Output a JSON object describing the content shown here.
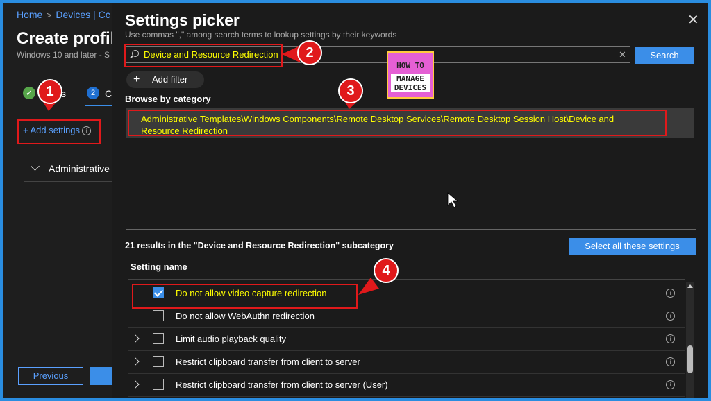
{
  "breadcrumb": {
    "home": "Home",
    "devices": "Devices | Cc"
  },
  "profile": {
    "title": "Create profil",
    "subtitle": "Windows 10 and later - S",
    "step1_label": "s",
    "step2_number": "2",
    "step2_label": "C",
    "add_settings": "+ Add settings",
    "admin_row": "Administrative",
    "previous": "Previous"
  },
  "picker": {
    "title": "Settings picker",
    "hint": "Use commas \",\" among search terms to lookup settings by their keywords",
    "search_value": "Device and Resource Redirection",
    "search_button": "Search",
    "add_filter": "Add filter",
    "browse_label": "Browse by category",
    "category_path": "Administrative Templates\\Windows Components\\Remote Desktop Services\\Remote Desktop Session Host\\Device and Resource Redirection",
    "results_text": "21 results in the \"Device and Resource Redirection\" subcategory",
    "select_all": "Select all these settings",
    "column_header": "Setting name",
    "rows": [
      {
        "name": "Do not allow video capture redirection",
        "checked": true,
        "expandable": false
      },
      {
        "name": "Do not allow WebAuthn redirection",
        "checked": false,
        "expandable": false
      },
      {
        "name": "Limit audio playback quality",
        "checked": false,
        "expandable": true
      },
      {
        "name": "Restrict clipboard transfer from client to server",
        "checked": false,
        "expandable": true
      },
      {
        "name": "Restrict clipboard transfer from client to server (User)",
        "checked": false,
        "expandable": true
      }
    ]
  },
  "logo": {
    "line1": "HOW TO",
    "line2": "MANAGE",
    "line3": "DEVICES"
  },
  "callouts": [
    "1",
    "2",
    "3",
    "4"
  ],
  "colors": {
    "accent": "#3b8ee8",
    "highlight": "#ffff00",
    "callout": "#e0191b",
    "background": "#1b1b1b"
  },
  "icons": [
    "chevron-right-icon",
    "search-icon",
    "close-icon",
    "info-icon",
    "plus-icon",
    "checkmark-icon",
    "chevron-down-icon"
  ]
}
